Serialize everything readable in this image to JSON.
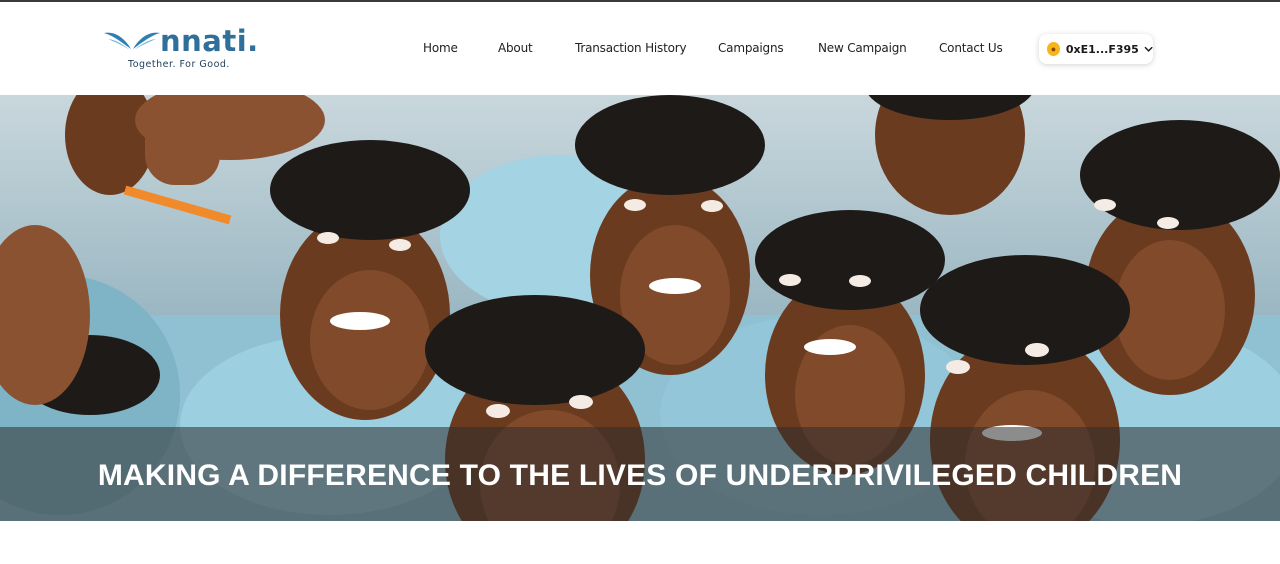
{
  "brand": {
    "wordmark": "nnati.",
    "tagline": "Together. For Good.",
    "color": "#2f6f99"
  },
  "nav": {
    "items": [
      {
        "label": "Home"
      },
      {
        "label": "About"
      },
      {
        "label": "Transaction History"
      },
      {
        "label": "Campaigns"
      },
      {
        "label": "New Campaign"
      },
      {
        "label": "Contact Us"
      }
    ]
  },
  "wallet": {
    "address": "0xE1...F395",
    "icon": "metamask-fox-icon",
    "chevron": "chevron-down-icon"
  },
  "hero": {
    "title": "MAKING A DIFFERENCE TO THE LIVES OF UNDERPRIVILEGED CHILDREN",
    "image_subject": "group-of-smiling-schoolchildren-photo"
  }
}
